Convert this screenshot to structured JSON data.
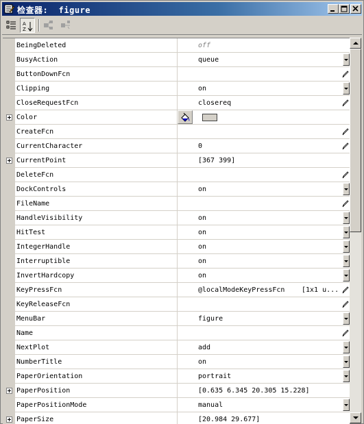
{
  "window": {
    "title": "检查器:  figure",
    "controls": {
      "minimize": "minimize-icon",
      "maximize": "maximize-icon",
      "close": "close-icon"
    }
  },
  "toolbar": {
    "buttons": [
      {
        "icon": "categorized-view-icon",
        "pressed": false
      },
      {
        "icon": "alphabetical-sort-icon",
        "pressed": true
      },
      {
        "icon": "expand-all-icon",
        "pressed": false
      },
      {
        "icon": "collapse-all-icon",
        "pressed": false
      }
    ]
  },
  "properties": [
    {
      "name": "BeingDeleted",
      "value": "off",
      "dim": true,
      "editor": "none",
      "expandable": false
    },
    {
      "name": "BusyAction",
      "value": "queue",
      "editor": "dropdown",
      "expandable": false
    },
    {
      "name": "ButtonDownFcn",
      "value": "",
      "editor": "pen",
      "expandable": false
    },
    {
      "name": "Clipping",
      "value": "on",
      "editor": "dropdown",
      "expandable": false
    },
    {
      "name": "CloseRequestFcn",
      "value": "closereq",
      "editor": "pen",
      "expandable": false
    },
    {
      "name": "Color",
      "value": "",
      "editor": "color",
      "expandable": true,
      "swatch_color": "#d4d0c8"
    },
    {
      "name": "CreateFcn",
      "value": "",
      "editor": "pen",
      "expandable": false
    },
    {
      "name": "CurrentCharacter",
      "value": "0",
      "editor": "pen",
      "expandable": false
    },
    {
      "name": "CurrentPoint",
      "value": "[367 399]",
      "editor": "none",
      "expandable": true
    },
    {
      "name": "DeleteFcn",
      "value": "",
      "editor": "pen",
      "expandable": false
    },
    {
      "name": "DockControls",
      "value": "on",
      "editor": "dropdown",
      "expandable": false
    },
    {
      "name": "FileName",
      "value": "",
      "editor": "pen",
      "expandable": false
    },
    {
      "name": "HandleVisibility",
      "value": "on",
      "editor": "dropdown",
      "expandable": false
    },
    {
      "name": "HitTest",
      "value": "on",
      "editor": "dropdown",
      "expandable": false
    },
    {
      "name": "IntegerHandle",
      "value": "on",
      "editor": "dropdown",
      "expandable": false
    },
    {
      "name": "Interruptible",
      "value": "on",
      "editor": "dropdown",
      "expandable": false
    },
    {
      "name": "InvertHardcopy",
      "value": "on",
      "editor": "dropdown",
      "expandable": false
    },
    {
      "name": "KeyPressFcn",
      "value": "@localModeKeyPressFcn",
      "value2": "[1x1 u...",
      "editor": "pen",
      "expandable": false
    },
    {
      "name": "KeyReleaseFcn",
      "value": "",
      "editor": "pen",
      "expandable": false
    },
    {
      "name": "MenuBar",
      "value": "figure",
      "editor": "dropdown",
      "expandable": false
    },
    {
      "name": "Name",
      "value": "",
      "editor": "pen",
      "expandable": false
    },
    {
      "name": "NextPlot",
      "value": "add",
      "editor": "dropdown",
      "expandable": false
    },
    {
      "name": "NumberTitle",
      "value": "on",
      "editor": "dropdown",
      "expandable": false
    },
    {
      "name": "PaperOrientation",
      "value": "portrait",
      "editor": "dropdown",
      "expandable": false
    },
    {
      "name": "PaperPosition",
      "value": "[0.635 6.345 20.305 15.228]",
      "editor": "none",
      "expandable": true
    },
    {
      "name": "PaperPositionMode",
      "value": "manual",
      "editor": "dropdown",
      "expandable": false
    },
    {
      "name": "PaperSize",
      "value": "[20.984 29.677]",
      "editor": "none",
      "expandable": true
    }
  ],
  "colors": {
    "titlebar_start": "#0a246a",
    "titlebar_end": "#a6caf0",
    "chrome": "#d4d0c8"
  }
}
